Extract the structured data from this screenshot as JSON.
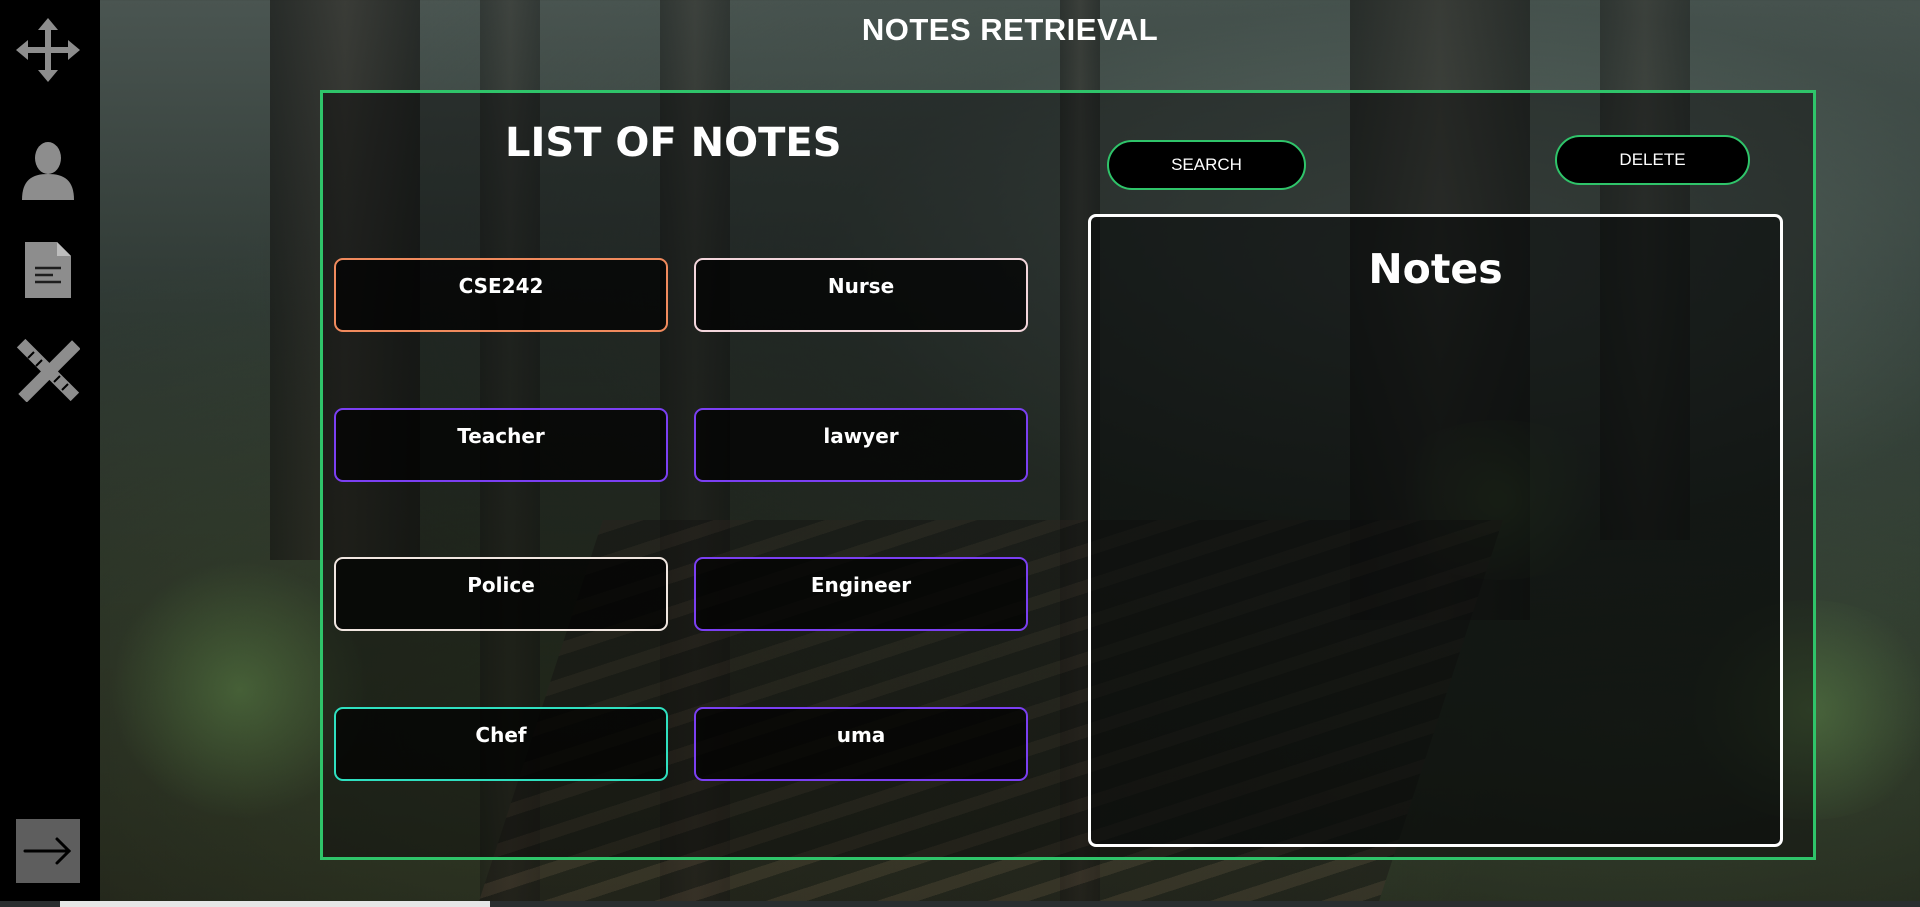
{
  "app": {
    "title": "NOTES RETRIEVAL"
  },
  "sidebar": {
    "items": [
      {
        "icon": "move-icon"
      },
      {
        "icon": "user-icon"
      },
      {
        "icon": "document-icon"
      },
      {
        "icon": "tools-icon"
      }
    ],
    "logout_icon": "logout-arrow-icon"
  },
  "list": {
    "title": "LIST OF NOTES",
    "notes": [
      {
        "label": "CSE242",
        "color": "#f08a5d"
      },
      {
        "label": "Nurse",
        "color": "#f3d6dc"
      },
      {
        "label": "Teacher",
        "color": "#7b3ff2"
      },
      {
        "label": "lawyer",
        "color": "#7b3ff2"
      },
      {
        "label": "Police",
        "color": "#f0e6e0"
      },
      {
        "label": "Engineer",
        "color": "#7b3ff2"
      },
      {
        "label": "Chef",
        "color": "#2fe0c0"
      },
      {
        "label": "uma",
        "color": "#7b3ff2"
      }
    ]
  },
  "actions": {
    "search_label": "SEARCH",
    "delete_label": "DELETE"
  },
  "notes_panel": {
    "title": "Notes"
  },
  "colors": {
    "accent": "#2fc46a",
    "sidebar": "#000000"
  }
}
